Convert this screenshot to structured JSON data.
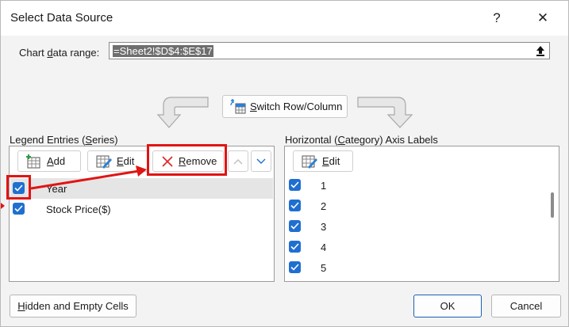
{
  "window": {
    "title": "Select Data Source",
    "help_glyph": "?",
    "close_glyph": "✕"
  },
  "range": {
    "label_pre": "Chart ",
    "label_u": "d",
    "label_post": "ata range:",
    "value": "=Sheet2!$D$4:$E$17"
  },
  "switch": {
    "pre": "",
    "u": "S",
    "post": "witch Row/Column"
  },
  "legend": {
    "label_pre": "Legend Entries (",
    "label_u": "S",
    "label_post": "eries)",
    "add": {
      "u": "A",
      "post": "dd"
    },
    "edit": {
      "u": "E",
      "post": "dit"
    },
    "remove": {
      "u": "R",
      "post": "emove"
    },
    "items": [
      {
        "label": "Year",
        "checked": true,
        "selected": true
      },
      {
        "label": "Stock Price($)",
        "checked": true,
        "selected": false
      }
    ]
  },
  "axis": {
    "label_pre": "Horizontal (",
    "label_u": "C",
    "label_post": "ategory) Axis Labels",
    "edit": {
      "u": "E",
      "post": "dit"
    },
    "items": [
      "1",
      "2",
      "3",
      "4",
      "5"
    ]
  },
  "buttons": {
    "hidden": {
      "u": "H",
      "post": "idden and Empty Cells"
    },
    "ok": "OK",
    "cancel": "Cancel"
  },
  "colors": {
    "accent": "#1f6fd1",
    "highlight": "#e11414"
  }
}
